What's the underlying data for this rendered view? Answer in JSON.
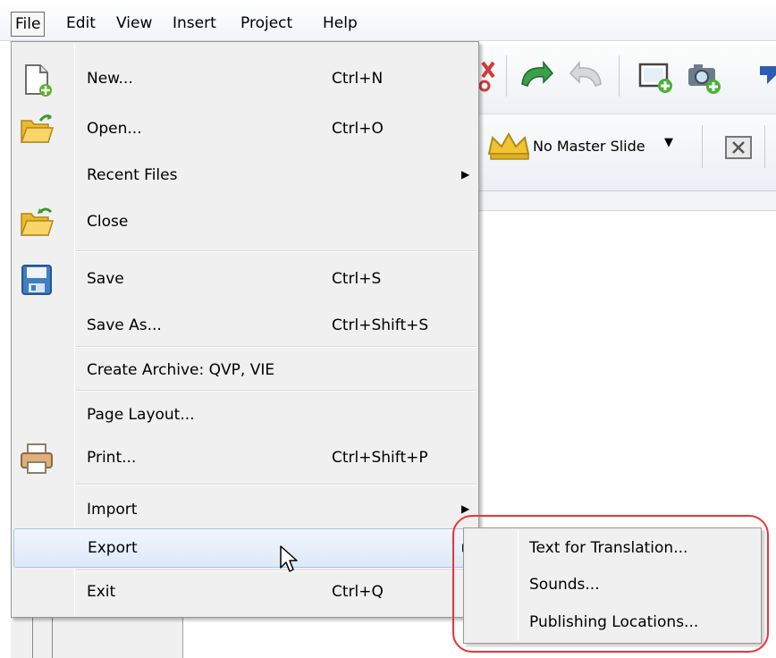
{
  "menubar": {
    "items": [
      {
        "key": "file",
        "label": "File"
      },
      {
        "key": "edit",
        "label": "Edit"
      },
      {
        "key": "view",
        "label": "View"
      },
      {
        "key": "insert",
        "label": "Insert"
      },
      {
        "key": "project",
        "label": "Project"
      },
      {
        "key": "help",
        "label": "Help"
      }
    ]
  },
  "toolbar": {
    "master_slide_label": "No Master Slide"
  },
  "file_menu": {
    "items": [
      {
        "label": "New...",
        "shortcut": "Ctrl+N",
        "icon": "new-file-icon"
      },
      {
        "label": "Open...",
        "shortcut": "Ctrl+O",
        "icon": "open-folder-icon"
      },
      {
        "label": "Recent Files",
        "shortcut": "",
        "submenu": true
      },
      {
        "label": "Close",
        "shortcut": "",
        "icon": "close-folder-icon"
      },
      {
        "label": "Save",
        "shortcut": "Ctrl+S",
        "icon": "save-disk-icon"
      },
      {
        "label": "Save As...",
        "shortcut": "Ctrl+Shift+S"
      },
      {
        "label": "Create Archive: QVP, VIE",
        "shortcut": ""
      },
      {
        "label": "Page Layout...",
        "shortcut": ""
      },
      {
        "label": "Print...",
        "shortcut": "Ctrl+Shift+P",
        "icon": "printer-icon"
      },
      {
        "label": "Import",
        "shortcut": "",
        "submenu": true
      },
      {
        "label": "Export",
        "shortcut": "",
        "submenu": true,
        "highlighted": true
      },
      {
        "label": "Exit",
        "shortcut": "Ctrl+Q"
      }
    ]
  },
  "export_submenu": {
    "items": [
      {
        "label": "Text for Translation..."
      },
      {
        "label": "Sounds..."
      },
      {
        "label": "Publishing Locations..."
      }
    ]
  },
  "colors": {
    "highlight_ring": "#e8363a",
    "menu_bg": "#f0f0f0",
    "menu_highlight": "#dde9f8"
  }
}
